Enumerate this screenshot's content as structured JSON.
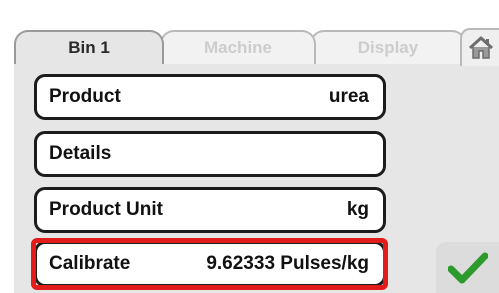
{
  "tabs": {
    "bin": "Bin 1",
    "machine": "Machine",
    "display": "Display"
  },
  "icons": {
    "home": "home-icon",
    "confirm": "checkmark-icon"
  },
  "fields": {
    "product": {
      "label": "Product",
      "value": "urea"
    },
    "details": {
      "label": "Details",
      "value": ""
    },
    "product_unit": {
      "label": "Product Unit",
      "value": "kg"
    },
    "calibrate": {
      "label": "Calibrate",
      "value": "9.62333 Pulses/kg"
    }
  },
  "colors": {
    "highlight": "#e21b1b",
    "confirm": "#2c9a2c"
  }
}
